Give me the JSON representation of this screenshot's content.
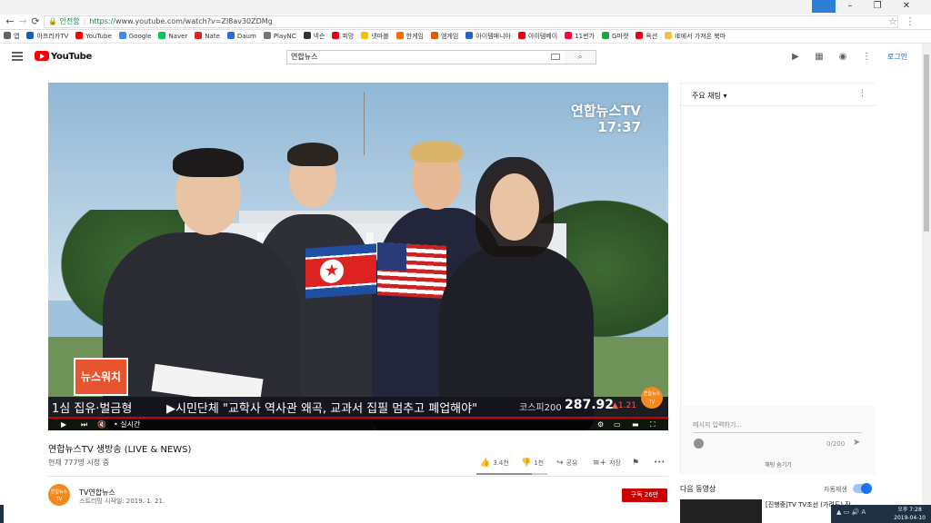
{
  "browser": {
    "controls": {
      "minimize": "–",
      "restore": "❐",
      "close": "✕"
    },
    "nav": {
      "back": "←",
      "forward": "→",
      "reload": "⟳"
    },
    "address": {
      "security_label": "안전함",
      "url_scheme": "https://",
      "url_rest": "www.youtube.com/watch?v=ZI8av30ZDMg"
    },
    "bookmarks": [
      {
        "label": "앱",
        "color": "#5f6368"
      },
      {
        "label": "아프리카TV",
        "color": "#1b5fb4"
      },
      {
        "label": "YouTube",
        "color": "#ff0000"
      },
      {
        "label": "Google",
        "color": "#4285f4"
      },
      {
        "label": "Naver",
        "color": "#03c75a"
      },
      {
        "label": "Nate",
        "color": "#e2231a"
      },
      {
        "label": "Daum",
        "color": "#2d6cd8"
      },
      {
        "label": "PlayNC",
        "color": "#777777"
      },
      {
        "label": "넥슨",
        "color": "#333333"
      },
      {
        "label": "피망",
        "color": "#e3001b"
      },
      {
        "label": "넷마블",
        "color": "#f2c200"
      },
      {
        "label": "한게임",
        "color": "#ff6a00"
      },
      {
        "label": "엠게임",
        "color": "#e05a00"
      },
      {
        "label": "아이템매니아",
        "color": "#2b62c4"
      },
      {
        "label": "아이템베이",
        "color": "#e60012"
      },
      {
        "label": "11번가",
        "color": "#ff0038"
      },
      {
        "label": "G마켓",
        "color": "#22a345"
      },
      {
        "label": "옥션",
        "color": "#e60012"
      },
      {
        "label": "IE에서 가져온 북마",
        "color": "#f0c04a"
      }
    ]
  },
  "header": {
    "logo_text": "YouTube",
    "search_value": "연합뉴스",
    "login_label": "로그인",
    "icons": [
      "video-camera-icon",
      "apps-grid-icon",
      "messages-icon",
      "more-vert-icon"
    ]
  },
  "player": {
    "watermark_line1": "연합뉴스TV",
    "watermark_line2": "17:37",
    "badge": "뉴스워치",
    "ticker_left": "1심 집유·벌금형",
    "ticker_main": "▶시민단체 \"교학사 역사관 왜곡, 교과서 집필 멈추고 폐업해야\"",
    "kospi_label": "코스피200",
    "kospi_value": "287.92",
    "kospi_change": "▲1.21",
    "logo_line1": "연합뉴스",
    "logo_line2": "TV",
    "live_label": "• 실시간"
  },
  "video": {
    "title": "연합뉴스TV 생방송 (LIVE & NEWS)",
    "viewers": "현재 777명 시청 중",
    "likes": "3.4천",
    "dislikes": "1천",
    "share": "공유",
    "save": "저장",
    "more": "•••",
    "like_ratio": 0.78
  },
  "channel": {
    "name": "TV연합뉴스",
    "avatar_line1": "연합뉴스",
    "avatar_line2": "TV",
    "stream_start": "스트리밍 시작일: 2019. 1. 21.",
    "subscribe": "구독 26만"
  },
  "chat": {
    "mode": "주요 채팅 ▾",
    "more": "⋮",
    "input_placeholder": "메시지 입력하기...",
    "char_count": "0/200",
    "hide": "채팅 숨기기"
  },
  "upnext": {
    "label": "다음 동영상",
    "autoplay": "자동재생",
    "next_title": "[진행중]TV TV조선 (가려도) 잔"
  },
  "taskbar": {
    "time": "오후 7:28",
    "date": "2019-04-10"
  }
}
